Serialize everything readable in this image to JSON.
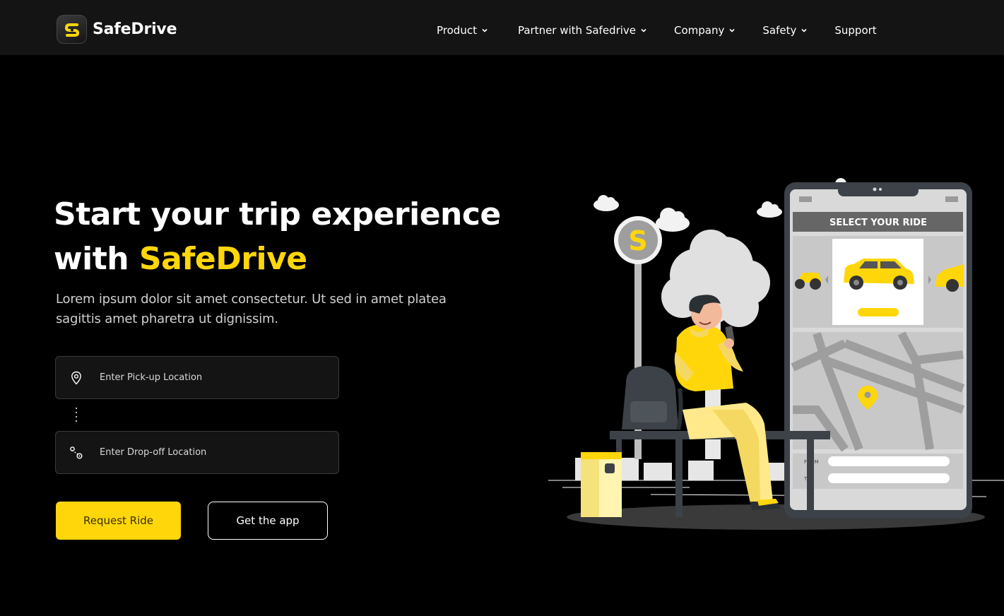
{
  "brand": {
    "name": "SafeDrive",
    "accent": "#FFD60A"
  },
  "nav": {
    "items": [
      {
        "label": "Product",
        "dropdown": true
      },
      {
        "label": "Partner with Safedrive",
        "dropdown": true
      },
      {
        "label": "Company",
        "dropdown": true
      },
      {
        "label": "Safety",
        "dropdown": true
      },
      {
        "label": "Support",
        "dropdown": false
      }
    ]
  },
  "hero": {
    "title_line1": "Start your trip experience",
    "title_line2_prefix": "with ",
    "title_line2_accent": "SafeDrive",
    "subtitle": "Lorem ipsum dolor sit amet consectetur. Ut sed in amet platea sagittis amet pharetra ut dignissim."
  },
  "form": {
    "pickup": {
      "placeholder": "Enter Pick-up Location",
      "value": "",
      "icon": "location-pin-icon"
    },
    "dropoff": {
      "placeholder": "Enter Drop-off Location",
      "value": "",
      "icon": "route-icon"
    }
  },
  "actions": {
    "request_label": "Request Ride",
    "app_label": "Get the app"
  },
  "phone_ui": {
    "header": "SELECT YOUR RIDE",
    "from_label": "FROM",
    "to_label": "TO",
    "logo_letter": "S"
  }
}
